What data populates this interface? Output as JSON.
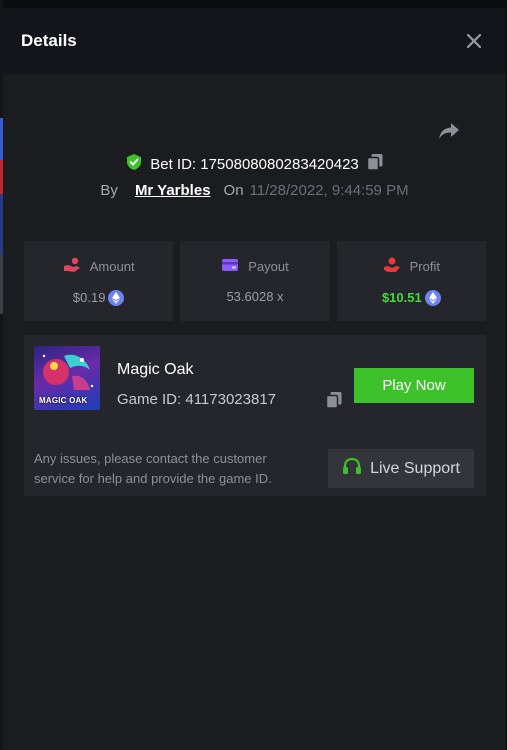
{
  "modal": {
    "title": "Details"
  },
  "bet": {
    "id_label": "Bet ID: 1750808080283420423",
    "by_label": "By",
    "username": "Mr Yarbles",
    "on_label": "On",
    "datetime": "11/28/2022, 9:44:59 PM"
  },
  "stats": {
    "amount": {
      "label": "Amount",
      "value": "$0.19"
    },
    "payout": {
      "label": "Payout",
      "value": "53.6028 x"
    },
    "profit": {
      "label": "Profit",
      "value": "$10.51"
    }
  },
  "game": {
    "name": "Magic Oak",
    "id_label": "Game ID: 41173023817",
    "thumbnail_text": "MAGIC OAK",
    "play_label": "Play Now",
    "note": "Any issues, please contact the customer service for help and provide the game ID.",
    "support_label": "Live Support"
  },
  "colors": {
    "accent_green": "#3dc22c",
    "profit_green": "#46d83c",
    "eth_blue": "#6e82f2",
    "amount_icon": "#e0455e",
    "payout_icon": "#8b5cf6",
    "profit_icon": "#e53b3b"
  },
  "icons": {
    "close": "close-icon",
    "share": "share-icon",
    "verified": "shield-check-icon",
    "copy": "copy-icon",
    "amount": "hand-coins-icon",
    "payout": "wallet-card-icon",
    "profit": "hand-money-icon",
    "currency": "eth-icon",
    "support": "headset-icon"
  }
}
